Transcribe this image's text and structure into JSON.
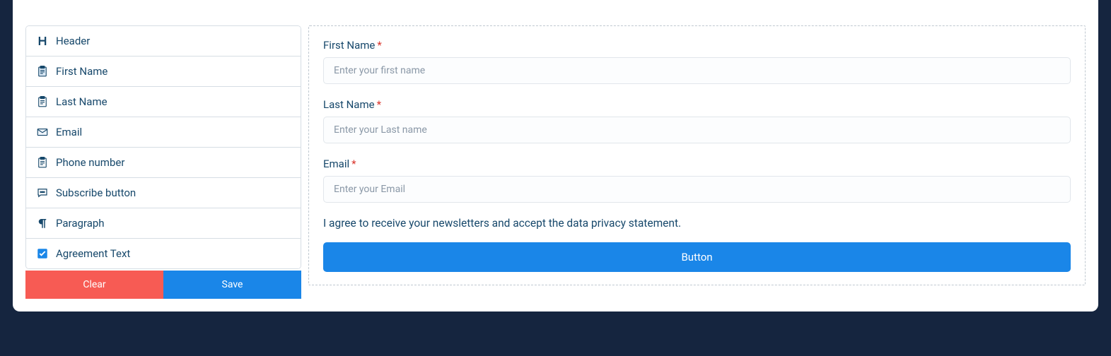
{
  "sidebar": {
    "items": [
      {
        "icon": "heading-icon",
        "label": "Header"
      },
      {
        "icon": "clipboard-icon",
        "label": "First Name"
      },
      {
        "icon": "clipboard-icon",
        "label": "Last Name"
      },
      {
        "icon": "mail-icon",
        "label": "Email"
      },
      {
        "icon": "clipboard-icon",
        "label": "Phone number"
      },
      {
        "icon": "message-icon",
        "label": "Subscribe button"
      },
      {
        "icon": "paragraph-icon",
        "label": "Paragraph"
      },
      {
        "icon": "checkbox-icon",
        "label": "Agreement Text"
      }
    ],
    "clear_label": "Clear",
    "save_label": "Save"
  },
  "form": {
    "first_name": {
      "label": "First Name",
      "placeholder": "Enter your first name"
    },
    "last_name": {
      "label": "Last Name",
      "placeholder": "Enter your Last name"
    },
    "email": {
      "label": "Email",
      "placeholder": "Enter your Email"
    },
    "agreement": "I agree to receive your newsletters and accept the data privacy statement.",
    "button_label": "Button"
  }
}
